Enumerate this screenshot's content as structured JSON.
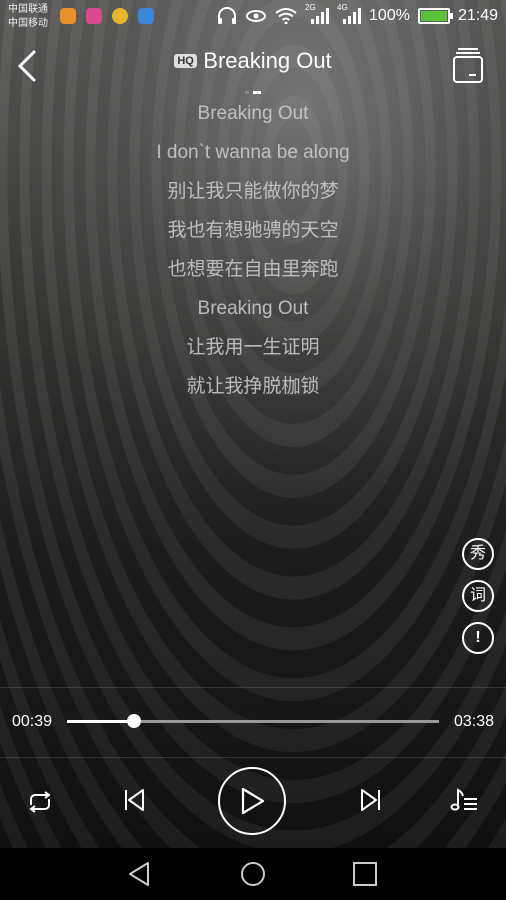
{
  "status_bar": {
    "carrier_1": "中国联通",
    "carrier_2": "中国移动",
    "battery_percent": "100%",
    "time": "21:49",
    "network_1": "2G",
    "network_2": "4G",
    "notification_icons": [
      "notif-app-icon-1",
      "notif-app-icon-2",
      "notif-app-icon-3",
      "notif-app-icon-4"
    ]
  },
  "header": {
    "quality_badge": "HQ",
    "song_title": "Breaking Out",
    "page_dots": 2,
    "active_dot": 1
  },
  "lyrics": [
    "Breaking Out",
    "I don`t wanna be along",
    "别让我只能做你的梦",
    "我也有想驰骋的天空",
    "也想要在自由里奔跑",
    "Breaking Out",
    "让我用一生证明",
    "就让我挣脱枷锁"
  ],
  "side_buttons": {
    "show": "秀",
    "lyrics": "词",
    "report": "!"
  },
  "progress": {
    "current_time": "00:39",
    "total_time": "03:38",
    "fraction": 0.18
  },
  "controls": {
    "repeat": "repeat-icon",
    "previous": "previous-icon",
    "play": "play-icon",
    "next": "next-icon",
    "playlist": "playlist-icon"
  },
  "nav_bar": {
    "back": "back-triangle-icon",
    "home": "home-circle-icon",
    "recents": "recents-square-icon"
  }
}
